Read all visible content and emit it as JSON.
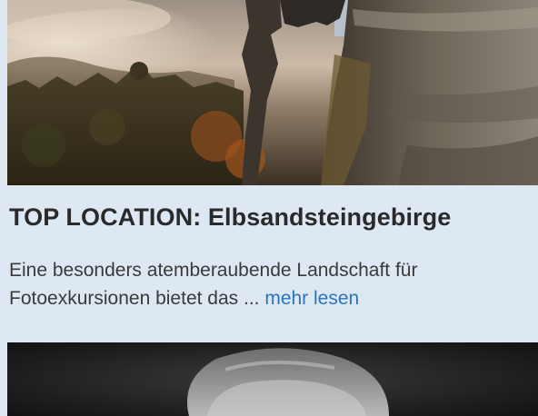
{
  "article": {
    "image_alt": "Sandstein-Felsen über nebligem Wald",
    "title": "TOP LOCATION: Elbsandsteingebirge",
    "excerpt": "Eine besonders atemberaubende Landschaft für Fotoexkursionen bietet das ... ",
    "read_more": "mehr lesen"
  },
  "next_article": {
    "image_alt": "Schwarzweiß-Portrait"
  },
  "colors": {
    "background": "#dde8f3",
    "link": "#2a74c0",
    "title": "#2a2a2a"
  }
}
